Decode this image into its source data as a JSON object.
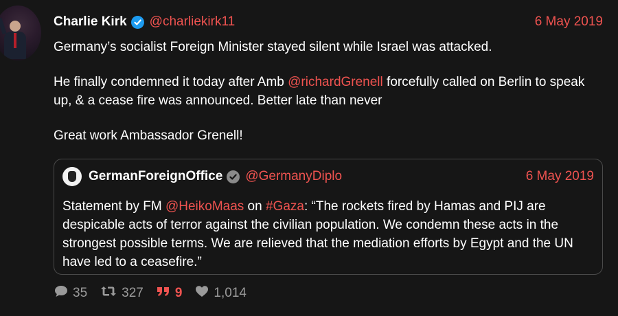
{
  "tweet": {
    "author_name": "Charlie Kirk",
    "handle": "@charliekirk11",
    "date": "6 May 2019",
    "line1": "Germany’s socialist Foreign Minister stayed silent while Israel was attacked.",
    "line2_pre": "He finally condemned it today after Amb ",
    "line2_mention": "@richardGrenell",
    "line2_post": " forcefully called on Berlin to speak up, & a cease fire was announced. Better late than never",
    "line3": "Great work Ambassador Grenell!"
  },
  "quoted": {
    "author_name": "GermanForeignOffice",
    "handle": "@GermanyDiplo",
    "date": "6 May 2019",
    "text_pre": "Statement by FM ",
    "mention": "@HeikoMaas",
    "text_mid": " on ",
    "hashtag": "#Gaza",
    "text_post": ": “The rockets fired by Hamas and PIJ are despicable acts of terror against the civilian population. We condemn these acts in the strongest possible terms. We are relieved that the mediation efforts by Egypt and the UN have led to a ceasefire.”"
  },
  "actions": {
    "replies": "35",
    "retweets": "327",
    "quotes": "9",
    "likes": "1,014",
    "reply_icon": "comment-icon",
    "retweet_icon": "retweet-icon",
    "quote_icon": "quote-icon",
    "like_icon": "heart-icon"
  },
  "colors": {
    "background": "#161616",
    "accent": "#ef5350",
    "muted": "#9a9a9a",
    "verified": "#1d9bf0"
  }
}
